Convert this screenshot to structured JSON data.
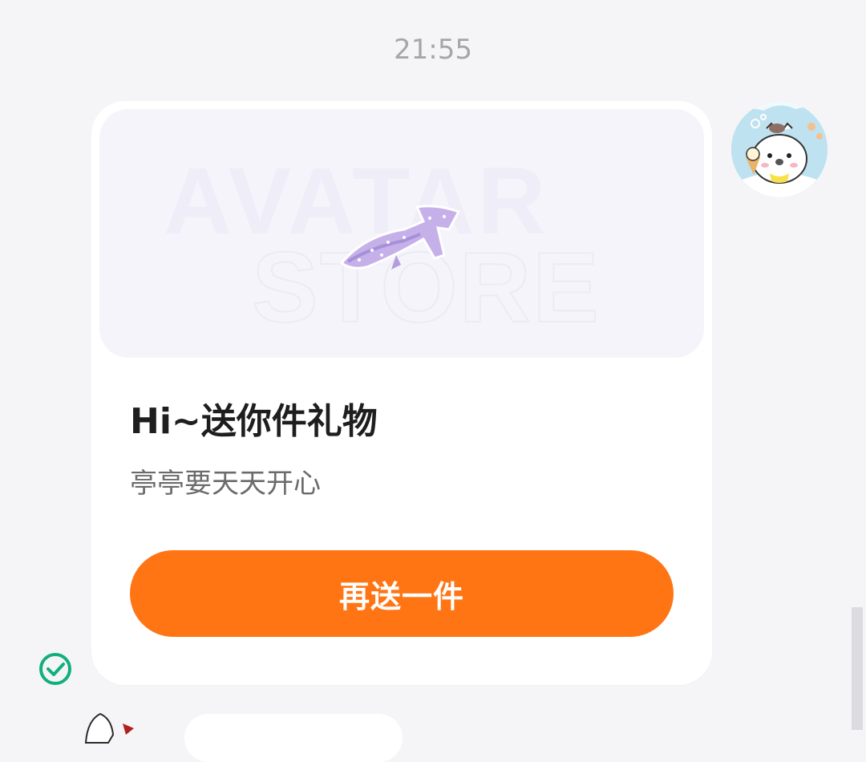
{
  "chat": {
    "timestamp": "21:55"
  },
  "gift_card": {
    "banner_watermark_line1": "AVATAR",
    "banner_watermark_line2": "STORE",
    "title": "Hi~送你件礼物",
    "subtitle": "亭亭要天天开心",
    "button_label": "再送一件"
  },
  "icons": {
    "avatar": "user-avatar-icon",
    "gift_image": "whale-shark-figure-icon",
    "status": "check-circle-icon"
  },
  "colors": {
    "accent": "#ff7514",
    "status_green": "#11b07a",
    "background": "#f5f5f7",
    "card": "#ffffff"
  }
}
